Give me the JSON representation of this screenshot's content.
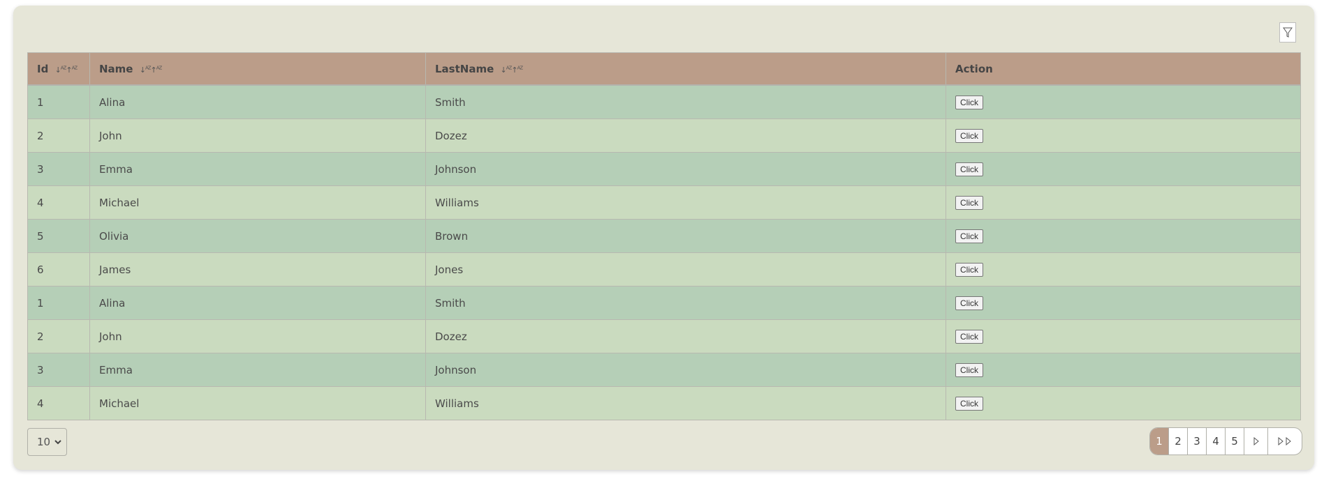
{
  "colors": {
    "card_background": "#e6e6d8",
    "header_background": "#bb9d89",
    "row_odd": "#b5cfb7",
    "row_even": "#cadbbf",
    "active_page": "#bb9d89"
  },
  "toolbar": {
    "filter_icon": "funnel-icon"
  },
  "table": {
    "columns": [
      {
        "label": "Id",
        "sortable": true,
        "sort_icons": "↓ᴬᶻ↑ᴬᶻ"
      },
      {
        "label": "Name",
        "sortable": true,
        "sort_icons": "↓ᴬᶻ↑ᴬᶻ"
      },
      {
        "label": "LastName",
        "sortable": true,
        "sort_icons": "↓ᴬᶻ↑ᴬᶻ"
      },
      {
        "label": "Action",
        "sortable": false
      }
    ],
    "rows": [
      {
        "id": "1",
        "name": "Alina",
        "lastname": "Smith",
        "action": "Click"
      },
      {
        "id": "2",
        "name": "John",
        "lastname": "Dozez",
        "action": "Click"
      },
      {
        "id": "3",
        "name": "Emma",
        "lastname": "Johnson",
        "action": "Click"
      },
      {
        "id": "4",
        "name": "Michael",
        "lastname": "Williams",
        "action": "Click"
      },
      {
        "id": "5",
        "name": "Olivia",
        "lastname": "Brown",
        "action": "Click"
      },
      {
        "id": "6",
        "name": "James",
        "lastname": "Jones",
        "action": "Click"
      },
      {
        "id": "1",
        "name": "Alina",
        "lastname": "Smith",
        "action": "Click"
      },
      {
        "id": "2",
        "name": "John",
        "lastname": "Dozez",
        "action": "Click"
      },
      {
        "id": "3",
        "name": "Emma",
        "lastname": "Johnson",
        "action": "Click"
      },
      {
        "id": "4",
        "name": "Michael",
        "lastname": "Williams",
        "action": "Click"
      }
    ]
  },
  "footer": {
    "page_size": "10",
    "pages": [
      "1",
      "2",
      "3",
      "4",
      "5"
    ],
    "current_page": "1",
    "next_icon": "▷",
    "last_icon": "▷▷"
  }
}
